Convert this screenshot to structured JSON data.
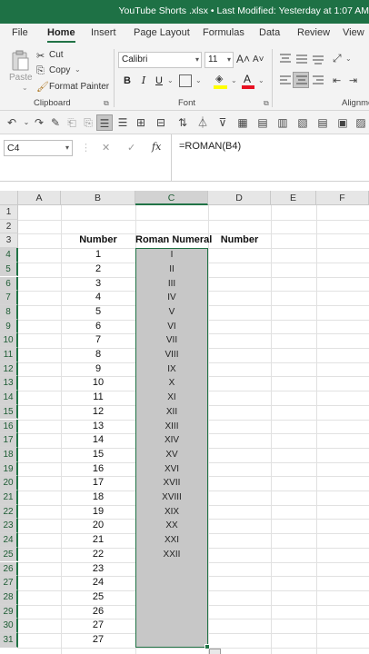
{
  "window": {
    "title": "YouTube Shorts .xlsx • Last Modified: Yesterday at 1:07 AM"
  },
  "tabs": [
    {
      "label": "File"
    },
    {
      "label": "Home",
      "active": true
    },
    {
      "label": "Insert"
    },
    {
      "label": "Page Layout"
    },
    {
      "label": "Formulas"
    },
    {
      "label": "Data"
    },
    {
      "label": "Review"
    },
    {
      "label": "View"
    }
  ],
  "ribbon": {
    "clipboard": {
      "paste_label": "Paste",
      "cut_label": "Cut",
      "copy_label": "Copy",
      "format_painter_label": "Format Painter",
      "group_label": "Clipboard"
    },
    "font": {
      "font_name": "Calibri",
      "font_size": "11",
      "bold": "B",
      "italic": "I",
      "underline": "U",
      "group_label": "Font"
    },
    "alignment": {
      "group_label": "Alignme"
    }
  },
  "formula_bar": {
    "name_box": "C4",
    "cancel_glyph": "✕",
    "enter_glyph": "✓",
    "fx_label": "fx",
    "formula": "=ROMAN(B4)"
  },
  "sheet": {
    "columns": [
      "A",
      "B",
      "C",
      "D",
      "E",
      "F"
    ],
    "selected_column": "C",
    "header_row": {
      "row": 3,
      "b": "Number",
      "c": "Roman Numeral",
      "d": "Number"
    },
    "rows": [
      {
        "row": "1",
        "b": "",
        "c": ""
      },
      {
        "row": "2",
        "b": "",
        "c": ""
      },
      {
        "row": "3",
        "b": "",
        "c": ""
      },
      {
        "row": "4",
        "b": "1",
        "c": "I"
      },
      {
        "row": "5",
        "b": "2",
        "c": "II"
      },
      {
        "row": "6",
        "b": "3",
        "c": "III"
      },
      {
        "row": "7",
        "b": "4",
        "c": "IV"
      },
      {
        "row": "8",
        "b": "5",
        "c": "V"
      },
      {
        "row": "9",
        "b": "6",
        "c": "VI"
      },
      {
        "row": "10",
        "b": "7",
        "c": "VII"
      },
      {
        "row": "11",
        "b": "8",
        "c": "VIII"
      },
      {
        "row": "12",
        "b": "9",
        "c": "IX"
      },
      {
        "row": "13",
        "b": "10",
        "c": "X"
      },
      {
        "row": "14",
        "b": "11",
        "c": "XI"
      },
      {
        "row": "15",
        "b": "12",
        "c": "XII"
      },
      {
        "row": "16",
        "b": "13",
        "c": "XIII"
      },
      {
        "row": "17",
        "b": "14",
        "c": "XIV"
      },
      {
        "row": "18",
        "b": "15",
        "c": "XV"
      },
      {
        "row": "19",
        "b": "16",
        "c": "XVI"
      },
      {
        "row": "20",
        "b": "17",
        "c": "XVII"
      },
      {
        "row": "21",
        "b": "18",
        "c": "XVIII"
      },
      {
        "row": "22",
        "b": "19",
        "c": "XIX"
      },
      {
        "row": "23",
        "b": "20",
        "c": "XX"
      },
      {
        "row": "24",
        "b": "21",
        "c": "XXI"
      },
      {
        "row": "25",
        "b": "22",
        "c": "XXII"
      },
      {
        "row": "26",
        "b": "23",
        "c": ""
      },
      {
        "row": "27",
        "b": "24",
        "c": ""
      },
      {
        "row": "28",
        "b": "25",
        "c": ""
      },
      {
        "row": "29",
        "b": "26",
        "c": ""
      },
      {
        "row": "30",
        "b": "27",
        "c": ""
      },
      {
        "row": "31",
        "b": "27",
        "c": ""
      }
    ]
  },
  "colors": {
    "accent": "#217346",
    "title_bar": "#1e7145",
    "selection_fill": "#c7c7c7"
  }
}
